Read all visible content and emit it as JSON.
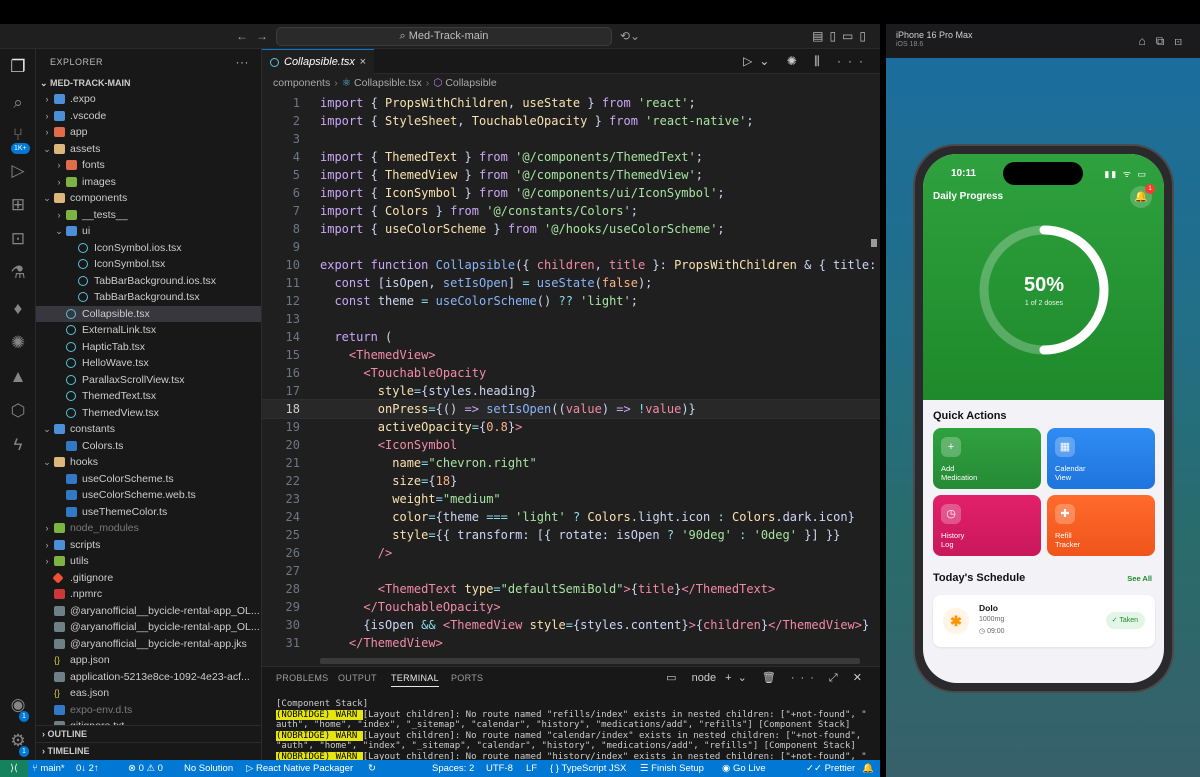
{
  "vscode": {
    "search": "Med-Track-main",
    "explorer_title": "EXPLORER",
    "root_folder": "MED-TRACK-MAIN",
    "tree": [
      {
        "label": ".expo",
        "depth": 0,
        "kind": "folder",
        "chev": "›"
      },
      {
        "label": ".vscode",
        "depth": 0,
        "kind": "folder",
        "chev": "›"
      },
      {
        "label": "app",
        "depth": 0,
        "kind": "folder-r",
        "chev": "›"
      },
      {
        "label": "assets",
        "depth": 0,
        "kind": "folder-y",
        "chev": "⌄"
      },
      {
        "label": "fonts",
        "depth": 1,
        "kind": "folder-r",
        "chev": "›"
      },
      {
        "label": "images",
        "depth": 1,
        "kind": "folder-g",
        "chev": "›"
      },
      {
        "label": "components",
        "depth": 0,
        "kind": "folder-y",
        "chev": "⌄"
      },
      {
        "label": "__tests__",
        "depth": 1,
        "kind": "folder-g",
        "chev": "›"
      },
      {
        "label": "ui",
        "depth": 1,
        "kind": "folder",
        "chev": "⌄"
      },
      {
        "label": "IconSymbol.ios.tsx",
        "depth": 2,
        "kind": "react"
      },
      {
        "label": "IconSymbol.tsx",
        "depth": 2,
        "kind": "react"
      },
      {
        "label": "TabBarBackground.ios.tsx",
        "depth": 2,
        "kind": "react"
      },
      {
        "label": "TabBarBackground.tsx",
        "depth": 2,
        "kind": "react"
      },
      {
        "label": "Collapsible.tsx",
        "depth": 1,
        "kind": "react",
        "selected": true
      },
      {
        "label": "ExternalLink.tsx",
        "depth": 1,
        "kind": "react"
      },
      {
        "label": "HapticTab.tsx",
        "depth": 1,
        "kind": "react"
      },
      {
        "label": "HelloWave.tsx",
        "depth": 1,
        "kind": "react"
      },
      {
        "label": "ParallaxScrollView.tsx",
        "depth": 1,
        "kind": "react"
      },
      {
        "label": "ThemedText.tsx",
        "depth": 1,
        "kind": "react"
      },
      {
        "label": "ThemedView.tsx",
        "depth": 1,
        "kind": "react"
      },
      {
        "label": "constants",
        "depth": 0,
        "kind": "folder",
        "chev": "⌄"
      },
      {
        "label": "Colors.ts",
        "depth": 1,
        "kind": "ts"
      },
      {
        "label": "hooks",
        "depth": 0,
        "kind": "folder-y",
        "chev": "⌄"
      },
      {
        "label": "useColorScheme.ts",
        "depth": 1,
        "kind": "ts"
      },
      {
        "label": "useColorScheme.web.ts",
        "depth": 1,
        "kind": "ts"
      },
      {
        "label": "useThemeColor.ts",
        "depth": 1,
        "kind": "ts"
      },
      {
        "label": "node_modules",
        "depth": 0,
        "kind": "folder-g",
        "chev": "›",
        "dim": true
      },
      {
        "label": "scripts",
        "depth": 0,
        "kind": "folder",
        "chev": "›"
      },
      {
        "label": "utils",
        "depth": 0,
        "kind": "folder-g",
        "chev": "›"
      },
      {
        "label": ".gitignore",
        "depth": 0,
        "kind": "git"
      },
      {
        "label": ".npmrc",
        "depth": 0,
        "kind": "npm"
      },
      {
        "label": "@aryanofficial__bycicle-rental-app_OL...",
        "depth": 0,
        "kind": "file"
      },
      {
        "label": "@aryanofficial__bycicle-rental-app_OL...",
        "depth": 0,
        "kind": "file"
      },
      {
        "label": "@aryanofficial__bycicle-rental-app.jks",
        "depth": 0,
        "kind": "file"
      },
      {
        "label": "app.json",
        "depth": 0,
        "kind": "json"
      },
      {
        "label": "application-5213e8ce-1092-4e23-acf...",
        "depth": 0,
        "kind": "file"
      },
      {
        "label": "eas.json",
        "depth": 0,
        "kind": "json"
      },
      {
        "label": "expo-env.d.ts",
        "depth": 0,
        "kind": "ts",
        "dim": true
      },
      {
        "label": "gitignore.txt",
        "depth": 0,
        "kind": "file"
      }
    ],
    "outline": "OUTLINE",
    "timeline": "TIMELINE",
    "tab_label": "Collapsible.tsx",
    "breadcrumb": [
      "components",
      "Collapsible.tsx",
      "Collapsible"
    ],
    "code_lines": [
      {
        "n": "1",
        "html": "<span class='k'>import</span> { <span class='t'>PropsWithChildren</span>, <span class='t'>useState</span> } <span class='k'>from</span> <span class='s'>'react'</span>;"
      },
      {
        "n": "2",
        "html": "<span class='k'>import</span> { <span class='t'>StyleSheet</span>, <span class='t'>TouchableOpacity</span> } <span class='k'>from</span> <span class='s'>'react-native'</span>;"
      },
      {
        "n": "3",
        "html": ""
      },
      {
        "n": "4",
        "html": "<span class='k'>import</span> { <span class='t'>ThemedText</span> } <span class='k'>from</span> <span class='s'>'@/components/ThemedText'</span>;"
      },
      {
        "n": "5",
        "html": "<span class='k'>import</span> { <span class='t'>ThemedView</span> } <span class='k'>from</span> <span class='s'>'@/components/ThemedView'</span>;"
      },
      {
        "n": "6",
        "html": "<span class='k'>import</span> { <span class='t'>IconSymbol</span> } <span class='k'>from</span> <span class='s'>'@/components/ui/IconSymbol'</span>;"
      },
      {
        "n": "7",
        "html": "<span class='k'>import</span> { <span class='t'>Colors</span> } <span class='k'>from</span> <span class='s'>'@/constants/Colors'</span>;"
      },
      {
        "n": "8",
        "html": "<span class='k'>import</span> { <span class='t'>useColorScheme</span> } <span class='k'>from</span> <span class='s'>'@/hooks/useColorScheme'</span>;"
      },
      {
        "n": "9",
        "html": ""
      },
      {
        "n": "10",
        "html": "<span class='k'>export</span> <span class='k'>function</span> <span class='f'>Collapsible</span>({ <span class='v'>children</span>, <span class='v'>title</span> }: <span class='t'>PropsWithChildren</span> &amp; { <span class='c'>title:</span>"
      },
      {
        "n": "11",
        "html": "  <span class='k'>const</span> [<span class='c'>isOpen</span>, <span class='f'>setIsOpen</span>] <span class='o'>=</span> <span class='f'>useState</span>(<span class='n'>false</span>);"
      },
      {
        "n": "12",
        "html": "  <span class='k'>const</span> <span class='c'>theme</span> <span class='o'>=</span> <span class='f'>useColorScheme</span>() <span class='o'>??</span> <span class='s'>'light'</span>;"
      },
      {
        "n": "13",
        "html": ""
      },
      {
        "n": "14",
        "html": "  <span class='k'>return</span> ("
      },
      {
        "n": "15",
        "html": "    <span class='tag'>&lt;ThemedView&gt;</span>"
      },
      {
        "n": "16",
        "html": "      <span class='tag'>&lt;TouchableOpacity</span>"
      },
      {
        "n": "17",
        "html": "        <span class='a'>style</span><span class='o'>=</span>{<span class='c'>styles</span>.<span class='c'>heading</span>}"
      },
      {
        "n": "18",
        "html": "        <span class='a'>onPress</span><span class='o'>=</span>{() <span class='k'>=&gt;</span> <span class='f'>setIsOpen</span>((<span class='v'>value</span>) <span class='k'>=&gt;</span> <span class='o'>!</span><span class='v'>value</span>)}",
        "current": true
      },
      {
        "n": "19",
        "html": "        <span class='a'>activeOpacity</span><span class='o'>=</span>{<span class='n'>0.8</span>}<span class='tag'>&gt;</span>"
      },
      {
        "n": "20",
        "html": "        <span class='tag'>&lt;IconSymbol</span>"
      },
      {
        "n": "21",
        "html": "          <span class='a'>name</span><span class='o'>=</span><span class='s'>\"chevron.right\"</span>"
      },
      {
        "n": "22",
        "html": "          <span class='a'>size</span><span class='o'>=</span>{<span class='n'>18</span>}"
      },
      {
        "n": "23",
        "html": "          <span class='a'>weight</span><span class='o'>=</span><span class='s'>\"medium\"</span>"
      },
      {
        "n": "24",
        "html": "          <span class='a'>color</span><span class='o'>=</span>{<span class='c'>theme</span> <span class='o'>===</span> <span class='s'>'light'</span> <span class='o'>?</span> <span class='t'>Colors</span>.<span class='c'>light</span>.<span class='c'>icon</span> <span class='o'>:</span> <span class='t'>Colors</span>.<span class='c'>dark</span>.<span class='c'>icon</span>}"
      },
      {
        "n": "25",
        "html": "          <span class='a'>style</span><span class='o'>=</span>{{ <span class='c'>transform:</span> [{ <span class='c'>rotate:</span> <span class='c'>isOpen</span> <span class='o'>?</span> <span class='s'>'90deg'</span> <span class='o'>:</span> <span class='s'>'0deg'</span> }] }}"
      },
      {
        "n": "26",
        "html": "        <span class='tag'>/&gt;</span>"
      },
      {
        "n": "27",
        "html": ""
      },
      {
        "n": "28",
        "html": "        <span class='tag'>&lt;ThemedText</span> <span class='a'>type</span><span class='o'>=</span><span class='s'>\"defaultSemiBold\"</span><span class='tag'>&gt;</span>{<span class='v'>title</span>}<span class='tag'>&lt;/ThemedText&gt;</span>"
      },
      {
        "n": "29",
        "html": "      <span class='tag'>&lt;/TouchableOpacity&gt;</span>"
      },
      {
        "n": "30",
        "html": "      {<span class='c'>isOpen</span> <span class='o'>&amp;&amp;</span> <span class='tag'>&lt;ThemedView</span> <span class='a'>style</span><span class='o'>=</span>{<span class='c'>styles</span>.<span class='c'>content</span>}<span class='tag'>&gt;</span>{<span class='v'>children</span>}<span class='tag'>&lt;/ThemedView&gt;</span>}"
      },
      {
        "n": "31",
        "html": "    <span class='tag'>&lt;/ThemedView&gt;</span>"
      }
    ],
    "panel_tabs": [
      "PROBLEMS",
      "OUTPUT",
      "TERMINAL",
      "PORTS"
    ],
    "panel_active": "TERMINAL",
    "terminal_shell": "node",
    "terminal_lines": [
      {
        "text": "[Component Stack]"
      },
      {
        "warn": " (NOBRIDGE) WARN ",
        "text": " [Layout children]: No route named \"refills/index\" exists in nested children: [\"+not-found\", \""
      },
      {
        "text": "auth\", \"home\", \"index\", \"_sitemap\", \"calendar\", \"history\", \"medications/add\", \"refills\"] [Component Stack]"
      },
      {
        "warn": " (NOBRIDGE) WARN ",
        "text": " [Layout children]: No route named \"calendar/index\" exists in nested children: [\"+not-found\","
      },
      {
        "text": "\"auth\", \"home\", \"index\", \"_sitemap\", \"calendar\", \"history\", \"medications/add\", \"refills\"] [Component Stack]"
      },
      {
        "warn": " (NOBRIDGE) WARN ",
        "text": " [Layout children]: No route named \"history/index\" exists in nested children: [\"+not-found\", \""
      },
      {
        "text": "auth\", \"home\", \"index\", \"_sitemap\", \"calendar\", \"history\", \"medications/add\", \"refills\"] [Component Stack]"
      }
    ],
    "status": {
      "branch": "main*",
      "sync": "0↓ 2↑",
      "problems": "⊗ 0 ⚠ 0",
      "solution": "No Solution",
      "packager": "React Native Packager",
      "spaces": "Spaces: 2",
      "encoding": "UTF-8",
      "eol": "LF",
      "lang": "{ } TypeScript JSX",
      "finish_setup": "Finish Setup",
      "golive": "Go Live",
      "prettier": "Prettier"
    }
  },
  "simulator": {
    "device": "iPhone 16 Pro Max",
    "os": "iOS 18.6",
    "time": "10:11",
    "header_title": "Daily Progress",
    "bell_badge": "1",
    "progress_fraction": 0.5,
    "progress_text": "50%",
    "progress_sub": "1 of 2 doses",
    "quick_actions_title": "Quick Actions",
    "quick_actions": [
      {
        "label1": "Add",
        "label2": "Medication",
        "icon": "plus-circle-icon",
        "glyph": "+",
        "color": "green"
      },
      {
        "label1": "Calendar",
        "label2": "View",
        "icon": "calendar-icon",
        "glyph": "▦",
        "color": "blue"
      },
      {
        "label1": "History",
        "label2": "Log",
        "icon": "clock-icon",
        "glyph": "◷",
        "color": "pink"
      },
      {
        "label1": "Refill",
        "label2": "Tracker",
        "icon": "medical-icon",
        "glyph": "✚",
        "color": "orange"
      }
    ],
    "schedule_title": "Today's Schedule",
    "see_all": "See All",
    "schedule_item": {
      "name": "Dolo",
      "dose": "1000mg",
      "time": "09:00",
      "status": "Taken"
    }
  }
}
